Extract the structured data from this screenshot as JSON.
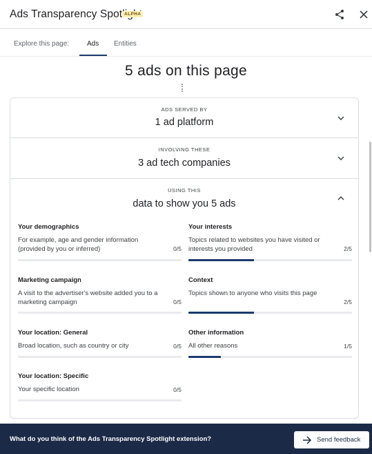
{
  "header": {
    "title": "Ads Transparency Spotlight",
    "badge": "ALPHA",
    "share_icon": "share-icon",
    "close_icon": "close-icon"
  },
  "tabs": {
    "label": "Explore this page:",
    "items": [
      {
        "label": "Ads",
        "active": true
      },
      {
        "label": "Entities",
        "active": false
      }
    ]
  },
  "summary": {
    "ads_count": "5 ads on this page"
  },
  "sections": [
    {
      "small": "ADS SERVED BY",
      "big": "1 ad platform",
      "expanded": false
    },
    {
      "small": "INVOLVING THESE",
      "big": "3 ad tech companies",
      "expanded": false
    },
    {
      "small": "USING THIS",
      "big": "data to show you 5 ads",
      "expanded": true
    }
  ],
  "data_items": [
    {
      "title": "Your demographics",
      "desc": "For example, age and gender information (provided by you or inferred)",
      "count": "0/5",
      "fraction": 0
    },
    {
      "title": "Your interests",
      "desc": "Topics related to websites you have visited or interests you provided",
      "count": "2/5",
      "fraction": 0.4
    },
    {
      "title": "Marketing campaign",
      "desc": "A visit to the advertiser's website added you to a marketing campaign",
      "count": "0/5",
      "fraction": 0
    },
    {
      "title": "Context",
      "desc": "Topics shown to anyone who visits this page",
      "count": "2/5",
      "fraction": 0.4
    },
    {
      "title": "Your location: General",
      "desc": "Broad location, such as country or city",
      "count": "0/5",
      "fraction": 0
    },
    {
      "title": "Other information",
      "desc": "All other reasons",
      "count": "1/5",
      "fraction": 0.2
    },
    {
      "title": "Your location: Specific",
      "desc": "Your specific location",
      "count": "0/5",
      "fraction": 0
    }
  ],
  "footer": {
    "question": "What do you think of the Ads Transparency Spotlight extension?",
    "button_label": "Send feedback",
    "button_icon": "arrow-right-icon"
  },
  "colors": {
    "accent": "#1a3a6b",
    "footer_bg": "#1b2a47",
    "badge_bg": "#fdf1b8"
  }
}
